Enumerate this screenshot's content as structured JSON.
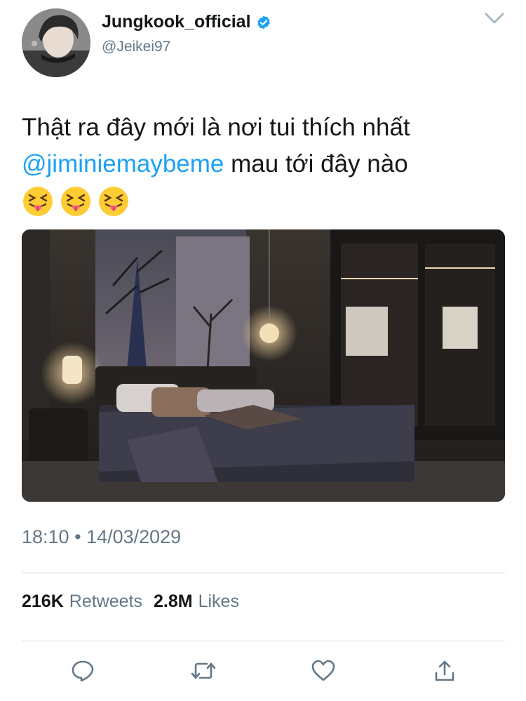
{
  "profile": {
    "display_name": "Jungkook_official",
    "handle": "@Jeikei97",
    "verified": true,
    "avatar_icon": "profile-photo"
  },
  "tweet": {
    "line1": "Thật ra đây mới là nơi tui thích nhất",
    "mention": "@jiminiemaybeme",
    "line2_rest": " mau tới đây nào",
    "emojis": [
      "squinting-face-with-tongue",
      "squinting-face-with-tongue",
      "squinting-face-with-tongue"
    ]
  },
  "media": {
    "icon": "bedroom-photo"
  },
  "meta": {
    "time": "18:10",
    "separator": "•",
    "date": "14/03/2029"
  },
  "stats": {
    "retweets_count": "216K",
    "retweets_label": "Retweets",
    "likes_count": "2.8M",
    "likes_label": "Likes"
  },
  "actions": [
    "reply-icon",
    "retweet-icon",
    "like-icon",
    "share-icon"
  ],
  "colors": {
    "accent": "#1da1f2",
    "muted": "#657786",
    "text": "#14171a",
    "divider": "#d4d8db"
  }
}
